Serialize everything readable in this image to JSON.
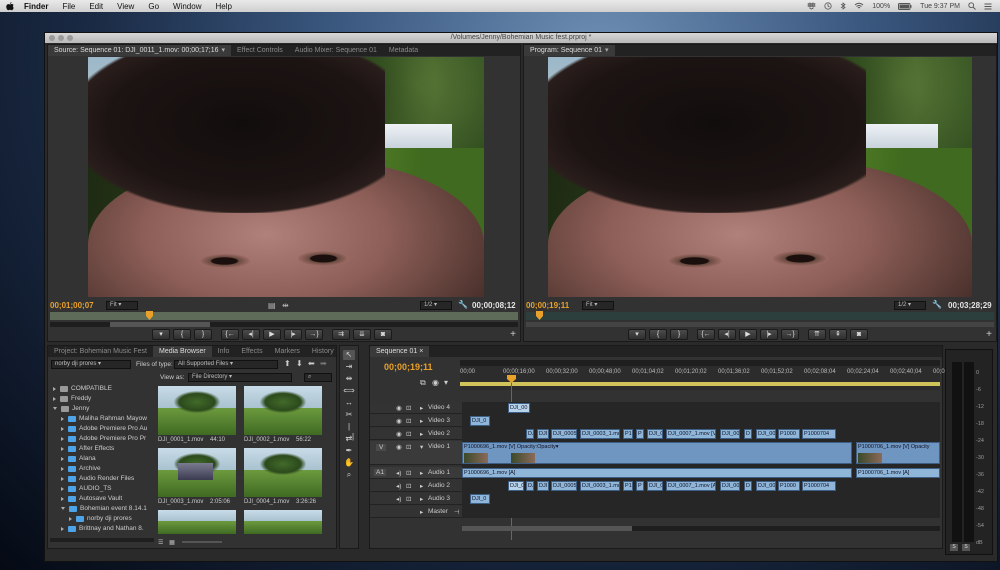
{
  "menubar": {
    "items": [
      "Finder",
      "File",
      "Edit",
      "View",
      "Go",
      "Window",
      "Help"
    ],
    "battery": "100%",
    "clock": "Tue 9:37 PM"
  },
  "window": {
    "title": "/Volumes/Jenny/Bohemian Music fest.prproj *"
  },
  "source": {
    "tabs": [
      "Source: Sequence 01: DJI_0011_1.mov: 00;00;17;16",
      "Effect Controls",
      "Audio Mixer: Sequence 01",
      "Metadata"
    ],
    "timecode_left": "00;01;00;07",
    "fit": "Fit",
    "zoom": "1/2",
    "timecode_right": "00;00;08;12"
  },
  "program": {
    "tabs": [
      "Program: Sequence 01"
    ],
    "timecode_left": "00;00;19;11",
    "fit": "Fit",
    "zoom": "1/2",
    "timecode_right": "00;03;28;29"
  },
  "browser": {
    "tabs": [
      "Project: Bohemian Music Fest",
      "Media Browser",
      "Info",
      "Effects",
      "Markers",
      "History"
    ],
    "location": "norby dji prores",
    "files_of_type_label": "Files of type:",
    "files_of_type": "All Supported Files",
    "view_as_label": "View as:",
    "view_as": "File Directory",
    "tree": [
      {
        "label": "COMPATIBLE",
        "kind": "drive",
        "depth": 1,
        "open": false
      },
      {
        "label": "Freddy",
        "kind": "drive",
        "depth": 1,
        "open": false
      },
      {
        "label": "Jenny",
        "kind": "drive",
        "depth": 1,
        "open": true
      },
      {
        "label": "Maliha Rahman Mayow",
        "kind": "folder",
        "depth": 2,
        "open": false
      },
      {
        "label": "Adobe Premiere Pro Au",
        "kind": "folder",
        "depth": 2,
        "open": false
      },
      {
        "label": "Adobe Premiere Pro Pr",
        "kind": "folder",
        "depth": 2,
        "open": false
      },
      {
        "label": "After Effects",
        "kind": "folder",
        "depth": 2,
        "open": false
      },
      {
        "label": "Alana",
        "kind": "folder",
        "depth": 2,
        "open": false
      },
      {
        "label": "Archive",
        "kind": "folder",
        "depth": 2,
        "open": false
      },
      {
        "label": "Audio Render Files",
        "kind": "folder",
        "depth": 2,
        "open": false
      },
      {
        "label": "AUDIO_TS",
        "kind": "folder",
        "depth": 2,
        "open": false
      },
      {
        "label": "Autosave Vault",
        "kind": "folder",
        "depth": 2,
        "open": false
      },
      {
        "label": "Bohemian event 8.14.1",
        "kind": "folder",
        "depth": 2,
        "open": true
      },
      {
        "label": "norby dji prores",
        "kind": "folder",
        "depth": 3,
        "open": false
      },
      {
        "label": "Brittnay and Nathan 8.",
        "kind": "folder",
        "depth": 2,
        "open": false
      }
    ],
    "thumbs": [
      {
        "name": "DJI_0001_1.mov",
        "dur": "44:10"
      },
      {
        "name": "DJI_0002_1.mov",
        "dur": "56:22"
      },
      {
        "name": "DJI_0003_1.mov",
        "dur": "2:05:06"
      },
      {
        "name": "DJI_0004_1.mov",
        "dur": "3:26:26"
      }
    ]
  },
  "timeline": {
    "tab": "Sequence 01",
    "timecode": "00;00;19;11",
    "ruler": [
      "00;00",
      "00;00;16;00",
      "00;00;32;00",
      "00;00;48;00",
      "00;01;04;02",
      "00;01;20;02",
      "00;01;36;02",
      "00;01;52;02",
      "00;02;08;04",
      "00;02;24;04",
      "00;02;40;04",
      "00;02;56;0"
    ],
    "tracks": {
      "v4": "Video 4",
      "v3": "Video 3",
      "v2": "Video 2",
      "v1": "Video 1",
      "a1": "Audio 1",
      "a2": "Audio 2",
      "a3": "Audio 3",
      "master": "Master",
      "v_label": "V",
      "a_label": "A1"
    },
    "clips": {
      "v4_1": "DJI_00",
      "v3_1": "DJI_0",
      "v2": [
        "DJI",
        "DJI",
        "DJI_0005_",
        "DJI_0003_1.mov",
        "P1",
        "P",
        "DJI_0",
        "DJI_0007_1.mov [V]",
        "DJI_00",
        "D",
        "DJI_00",
        "P1000",
        "P1000704"
      ],
      "v1_main": "P1000696_1.mov [V]  Opacity:Opacity▾",
      "v1_right": "P1000706_1.mov [V]  Opacity",
      "a1_main": "P1000696_1.mov [A]",
      "a1_right": "P1000706_1.mov [A]",
      "a2": [
        "DJI_00",
        "DJI",
        "DJI",
        "DJI_0005_",
        "DJI_0003_1.mov",
        "P1",
        "P",
        "DJI_0",
        "DJI_0007_1.mov [A]",
        "DJI_00",
        "D",
        "DJI_00",
        "P1000",
        "P1000704"
      ],
      "a3_1": "DJI_0"
    }
  },
  "meter": {
    "labels": [
      "0",
      "-6",
      "-12",
      "-18",
      "-24",
      "-30",
      "-36",
      "-42",
      "-48",
      "-54",
      "dB"
    ]
  }
}
